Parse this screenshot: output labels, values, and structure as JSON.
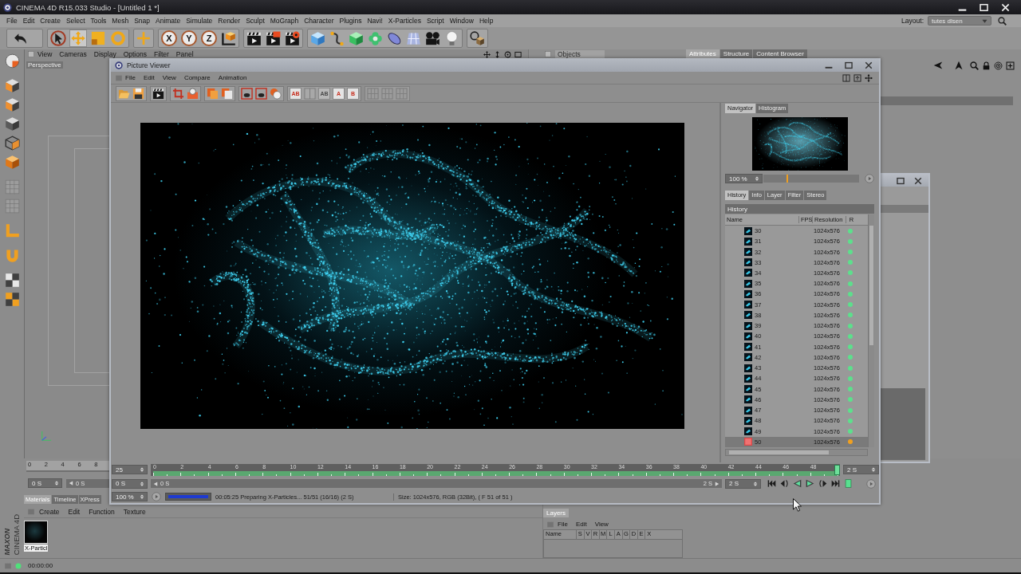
{
  "app": {
    "title": "CINEMA 4D R15.033 Studio - [Untitled 1 *]"
  },
  "menu": [
    "File",
    "Edit",
    "Create",
    "Select",
    "Tools",
    "Mesh",
    "Snap",
    "Animate",
    "Simulate",
    "Render",
    "Sculpt",
    "MoGraph",
    "Character",
    "Plugins",
    "Navi!",
    "X-Particles",
    "Script",
    "Window",
    "Help"
  ],
  "layout_selector": {
    "label": "Layout:",
    "value": "tutes dlsen"
  },
  "toolbar": {
    "transform_tools": [
      {
        "selected": false
      },
      {
        "selected": true
      },
      {
        "selected": false
      },
      {
        "selected": false
      }
    ],
    "axis_buttons": [
      "X",
      "Y",
      "Z"
    ]
  },
  "viewport": {
    "menu": [
      "View",
      "Cameras",
      "Display",
      "Options",
      "Filter",
      "Panel"
    ],
    "camera": "Perspective"
  },
  "objects_panel": {
    "tab": "Objects"
  },
  "attribute_tabs": [
    {
      "label": "Attributes",
      "selected": true
    },
    {
      "label": "Structure",
      "selected": false
    },
    {
      "label": "Content Browser",
      "selected": false
    }
  ],
  "picture_viewer": {
    "title": "Picture Viewer",
    "menu": [
      "File",
      "Edit",
      "View",
      "Compare",
      "Animation"
    ],
    "compare_buttons": [
      {
        "label": "AB",
        "disabled": false
      },
      {
        "label": "AB",
        "disabled": true
      },
      {
        "label": "A",
        "disabled": false
      },
      {
        "label": "B",
        "disabled": false
      }
    ],
    "navigator_tabs": [
      {
        "label": "Navigator",
        "selected": true
      },
      {
        "label": "Histogram",
        "selected": false
      }
    ],
    "zoom": {
      "value": "100 %",
      "level": 0.25
    },
    "panel_tabs": [
      {
        "label": "History",
        "selected": true
      },
      {
        "label": "Info",
        "selected": false
      },
      {
        "label": "Layer",
        "selected": false
      },
      {
        "label": "Filter",
        "selected": false
      },
      {
        "label": "Stereo",
        "selected": false
      }
    ],
    "history": {
      "title": "History",
      "columns": [
        "Name",
        "FPS",
        "Resolution",
        "R"
      ],
      "rows": [
        {
          "name": "30",
          "resolution": "1024x576",
          "color": "#5ce08c",
          "kind": "frame",
          "selected": false
        },
        {
          "name": "31",
          "resolution": "1024x576",
          "color": "#5ce08c",
          "kind": "frame",
          "selected": false
        },
        {
          "name": "32",
          "resolution": "1024x576",
          "color": "#5ce08c",
          "kind": "frame",
          "selected": false
        },
        {
          "name": "33",
          "resolution": "1024x576",
          "color": "#5ce08c",
          "kind": "frame",
          "selected": false
        },
        {
          "name": "34",
          "resolution": "1024x576",
          "color": "#5ce08c",
          "kind": "frame",
          "selected": false
        },
        {
          "name": "35",
          "resolution": "1024x576",
          "color": "#5ce08c",
          "kind": "frame",
          "selected": false
        },
        {
          "name": "36",
          "resolution": "1024x576",
          "color": "#5ce08c",
          "kind": "frame",
          "selected": false
        },
        {
          "name": "37",
          "resolution": "1024x576",
          "color": "#5ce08c",
          "kind": "frame",
          "selected": false
        },
        {
          "name": "38",
          "resolution": "1024x576",
          "color": "#5ce08c",
          "kind": "frame",
          "selected": false
        },
        {
          "name": "39",
          "resolution": "1024x576",
          "color": "#5ce08c",
          "kind": "frame",
          "selected": false
        },
        {
          "name": "40",
          "resolution": "1024x576",
          "color": "#5ce08c",
          "kind": "frame",
          "selected": false
        },
        {
          "name": "41",
          "resolution": "1024x576",
          "color": "#5ce08c",
          "kind": "frame",
          "selected": false
        },
        {
          "name": "42",
          "resolution": "1024x576",
          "color": "#5ce08c",
          "kind": "frame",
          "selected": false
        },
        {
          "name": "43",
          "resolution": "1024x576",
          "color": "#5ce08c",
          "kind": "frame",
          "selected": false
        },
        {
          "name": "44",
          "resolution": "1024x576",
          "color": "#5ce08c",
          "kind": "frame",
          "selected": false
        },
        {
          "name": "45",
          "resolution": "1024x576",
          "color": "#5ce08c",
          "kind": "frame",
          "selected": false
        },
        {
          "name": "46",
          "resolution": "1024x576",
          "color": "#5ce08c",
          "kind": "frame",
          "selected": false
        },
        {
          "name": "47",
          "resolution": "1024x576",
          "color": "#5ce08c",
          "kind": "frame",
          "selected": false
        },
        {
          "name": "48",
          "resolution": "1024x576",
          "color": "#5ce08c",
          "kind": "frame",
          "selected": false
        },
        {
          "name": "49",
          "resolution": "1024x576",
          "color": "#5ce08c",
          "kind": "frame",
          "selected": false
        },
        {
          "name": "50",
          "resolution": "1024x576",
          "color": "#f0a020",
          "kind": "rendering",
          "selected": true
        }
      ]
    },
    "timeline": {
      "left_field": "25",
      "ticks": [
        "0",
        "2",
        "4",
        "6",
        "8",
        "10",
        "12",
        "14",
        "16",
        "18",
        "20",
        "22",
        "24",
        "26",
        "28",
        "30",
        "32",
        "34",
        "36",
        "38",
        "40",
        "42",
        "44",
        "46",
        "48"
      ],
      "right_field": "2 S",
      "level": 1
    },
    "range": {
      "start": "0 S",
      "scroll_start": "0 S",
      "scroll_end": "2 S",
      "end": "2 S"
    },
    "status": {
      "zoom": "100 %",
      "progress": {
        "level": 1
      },
      "message": "00:05:25 Preparing X-Particles... 51/51 (16/16) (2 S)",
      "info": "Size: 1024x576, RGB (32Bit), ( F 51 of 51 )"
    }
  },
  "timeline_left": {
    "ticks": [
      "0",
      "2",
      "4",
      "6",
      "8"
    ],
    "start": "0 S",
    "scroll": "0 S"
  },
  "materials_panel": {
    "tabs": [
      {
        "label": "Materials",
        "selected": true
      },
      {
        "label": "Timeline",
        "selected": false
      },
      {
        "label": "XPress",
        "selected": false
      }
    ],
    "menu": [
      "Create",
      "Edit",
      "Function",
      "Texture"
    ],
    "materials": [
      {
        "name": "X-Particl"
      }
    ]
  },
  "layers_panel": {
    "tab": "Layers",
    "menu": [
      "File",
      "Edit",
      "View"
    ],
    "columns": [
      "Name",
      "S",
      "V",
      "R",
      "M",
      "L",
      "A",
      "G",
      "D",
      "E",
      "X"
    ]
  },
  "logo": {
    "brand": "MAXON",
    "product": "CINEMA 4D"
  },
  "status_bar": {
    "time": "00:00:00"
  }
}
